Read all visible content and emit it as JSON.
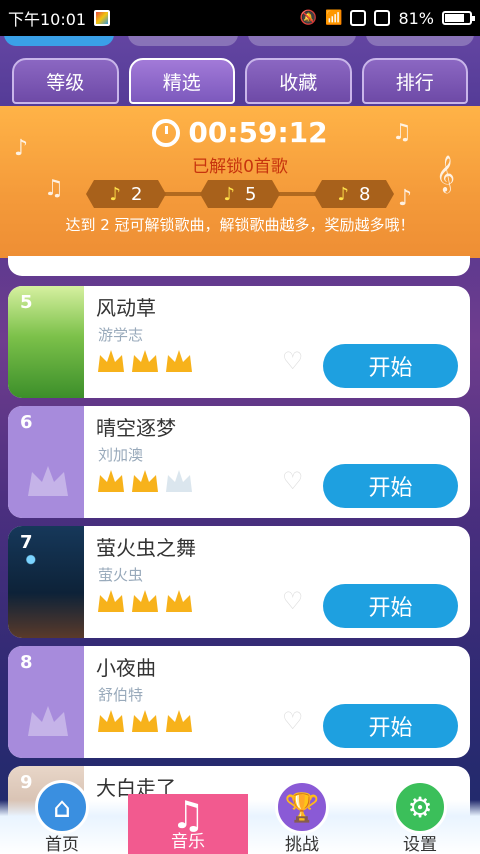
{
  "status_bar": {
    "time": "下午10:01",
    "battery": "81%",
    "battery_level": 0.81
  },
  "tabs": [
    {
      "label": "等级",
      "active": false
    },
    {
      "label": "精选",
      "active": true
    },
    {
      "label": "收藏",
      "active": false
    },
    {
      "label": "排行",
      "active": false
    }
  ],
  "banner": {
    "timer": "00:59:12",
    "unlocked_text": "已解锁0首歌",
    "milestones": [
      "2",
      "5",
      "8"
    ],
    "hint": "达到 2 冠可解锁歌曲，解锁歌曲越多，奖励越多哦！"
  },
  "songs": [
    {
      "num": "5",
      "title": "风动草",
      "artist": "游学志",
      "crowns_earned": 3,
      "crowns_total": 3,
      "button": "开始"
    },
    {
      "num": "6",
      "title": "晴空逐梦",
      "artist": "刘加澳",
      "crowns_earned": 2,
      "crowns_total": 3,
      "button": "开始"
    },
    {
      "num": "7",
      "title": "萤火虫之舞",
      "artist": "萤火虫",
      "crowns_earned": 3,
      "crowns_total": 3,
      "button": "开始"
    },
    {
      "num": "8",
      "title": "小夜曲",
      "artist": "舒伯特",
      "crowns_earned": 3,
      "crowns_total": 3,
      "button": "开始"
    },
    {
      "num": "9",
      "title": "大白走了",
      "artist": "",
      "crowns_earned": 0,
      "crowns_total": 0,
      "button": ""
    }
  ],
  "bottom_nav": [
    {
      "label": "首页",
      "icon": "home-icon",
      "color": "#3a8fe0"
    },
    {
      "label": "音乐",
      "icon": "music-note-icon",
      "color": "#f25a8f"
    },
    {
      "label": "挑战",
      "icon": "trophy-icon",
      "color": "#8a5ad6"
    },
    {
      "label": "设置",
      "icon": "gear-icon",
      "color": "#3bbf5a"
    }
  ],
  "colors": {
    "accent_blue": "#1ea0e0",
    "crown_gold": "#f7b21b",
    "banner_orange": "#f49a3a"
  }
}
